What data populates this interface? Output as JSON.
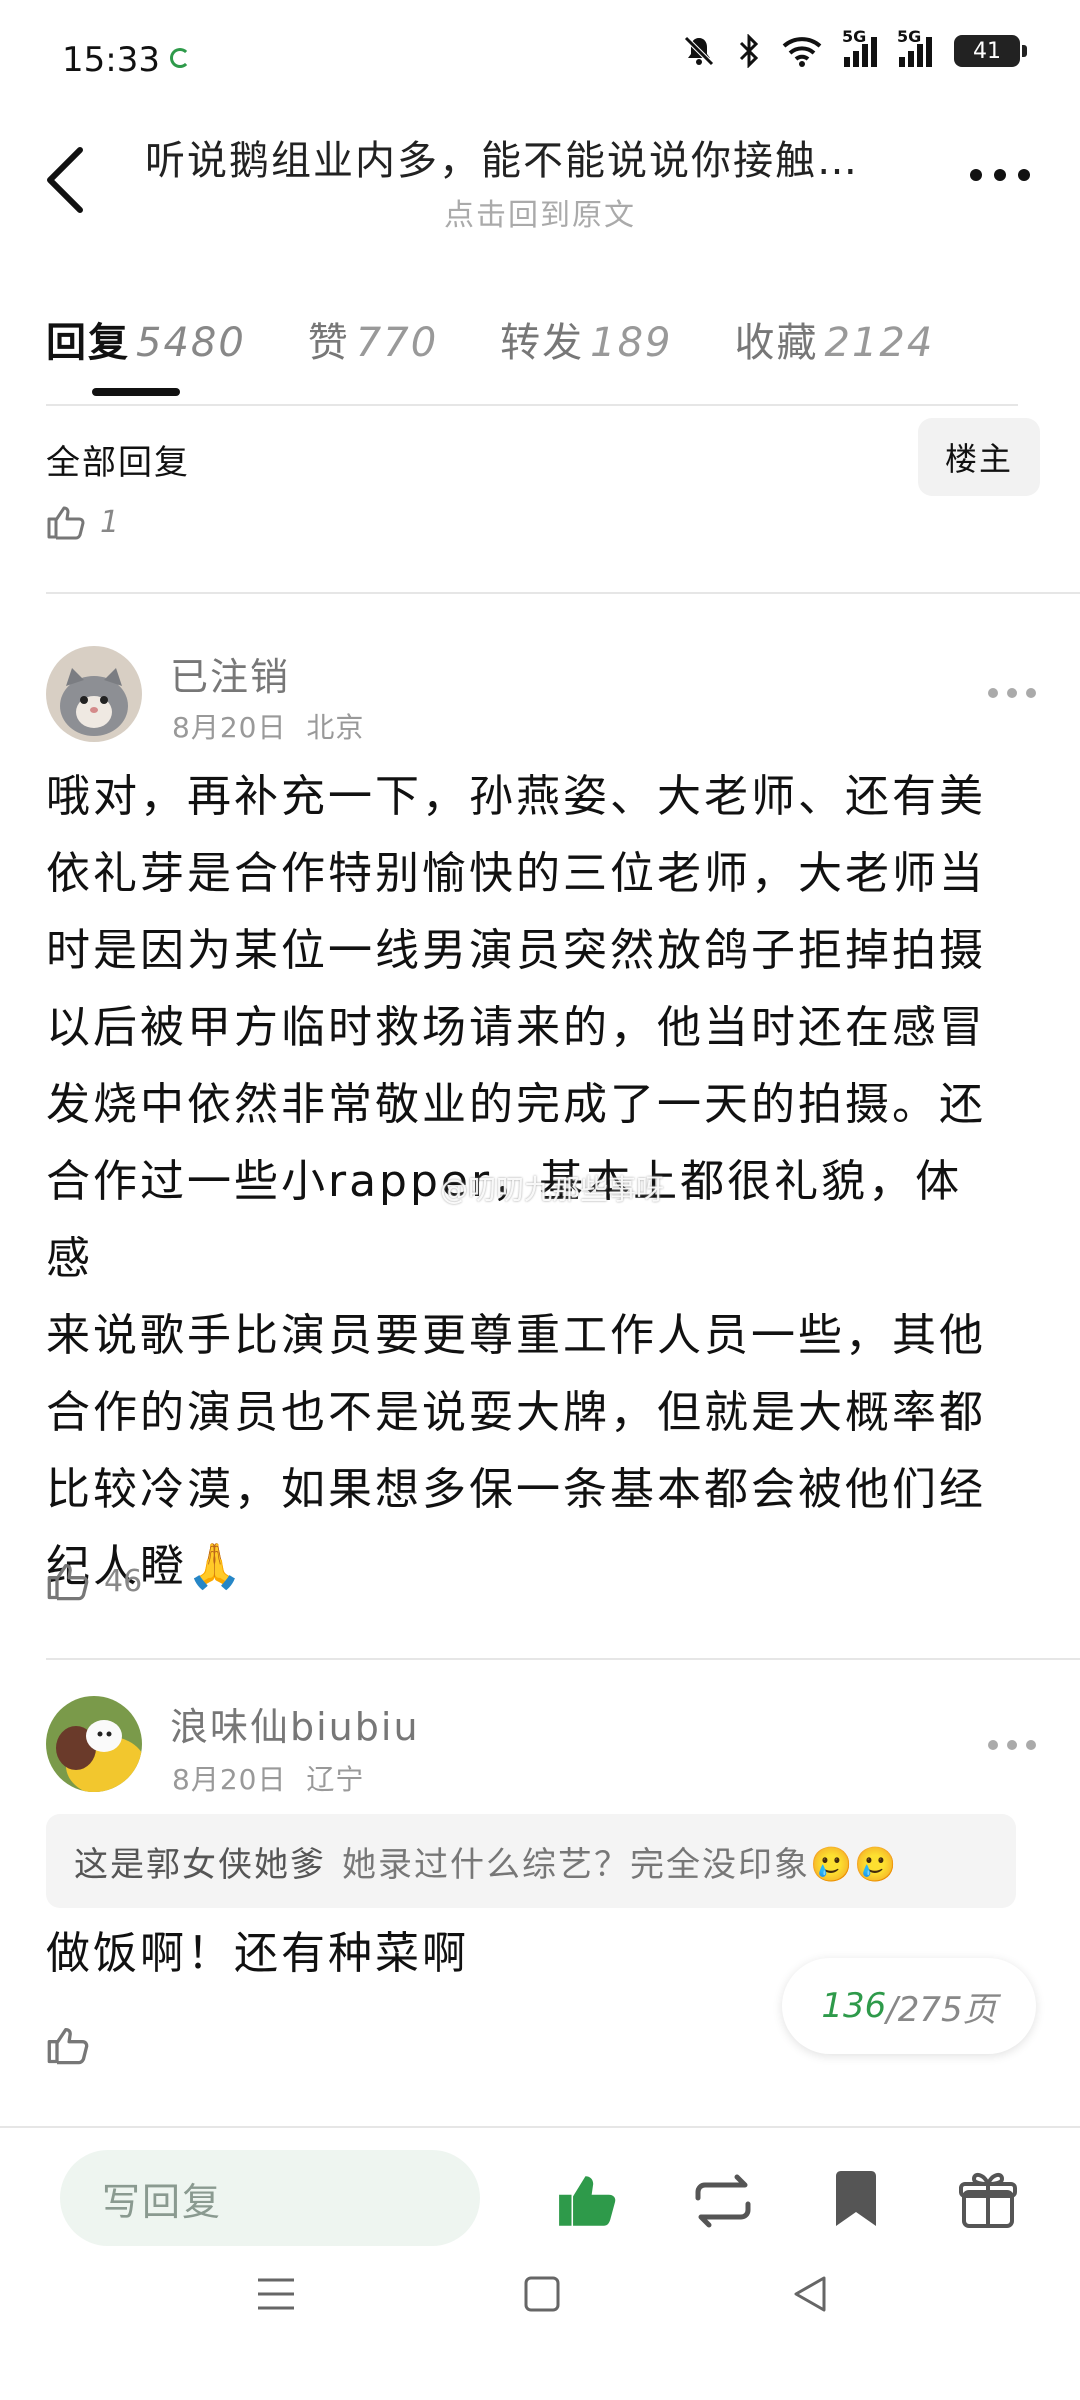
{
  "status_bar": {
    "time": "15:33",
    "battery": "41",
    "signal_label_1": "5G",
    "signal_label_2": "5G"
  },
  "header": {
    "title": "听说鹅组业内多，能不能说说你接触…",
    "subtitle": "点击回到原文"
  },
  "tabs": [
    {
      "label": "回复",
      "count": "5480"
    },
    {
      "label": "赞",
      "count": "770"
    },
    {
      "label": "转发",
      "count": "189"
    },
    {
      "label": "收藏",
      "count": "2124"
    }
  ],
  "filter": {
    "all_label": "全部回复",
    "owner_label": "楼主"
  },
  "post_like_count": "1",
  "comments": [
    {
      "name": "已注销",
      "date": "8月20日",
      "location": "北京",
      "body_lines": [
        "哦对，再补充一下，孙燕姿、大老师、还有美",
        "依礼芽是合作特别愉快的三位老师，大老师当",
        "时是因为某位一线男演员突然放鸽子拒掉拍摄",
        "以后被甲方临时救场请来的，他当时还在感冒",
        "发烧中依然非常敬业的完成了一天的拍摄。还",
        "合作过一些小rapper，基本上都很礼貌，体感",
        "来说歌手比演员要更尊重工作人员一些，其他",
        "合作的演员也不是说耍大牌，但就是大概率都",
        "比较冷漠，如果想多保一条基本都会被他们经",
        "纪人瞪🙏"
      ],
      "likes": "46"
    },
    {
      "name": "浪味仙biubiu",
      "date": "8月20日",
      "location": "辽宁",
      "quote_author": "这是郭女侠她爹",
      "quote_text": "她录过什么综艺？完全没印象🥲🥲",
      "body": "做饭啊！还有种菜啊"
    }
  ],
  "watermark": "@叨叨九那些事呀",
  "pagination": {
    "current": "136",
    "total": "/275页"
  },
  "bottom_bar": {
    "reply_placeholder": "写回复"
  },
  "colors": {
    "accent_green": "#2e9a4a",
    "input_bg": "#eef5f0"
  }
}
